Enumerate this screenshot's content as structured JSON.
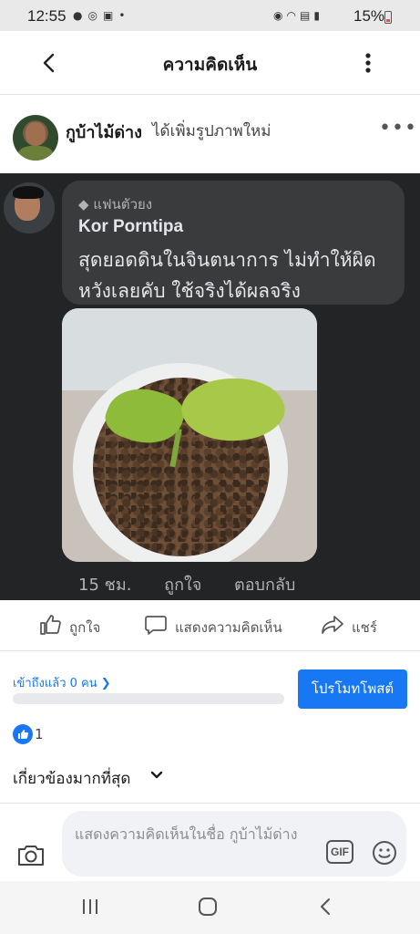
{
  "status_bar": {
    "time": "12:55",
    "battery_percent": "15%",
    "left_icons": [
      "messenger-icon",
      "sync-icon",
      "image-icon",
      "dot-icon"
    ],
    "right_icons": [
      "hotspot-icon",
      "wifi-icon",
      "volte-lte-icon",
      "signal-icon",
      "battery-icon"
    ]
  },
  "app_bar": {
    "title": "ความคิดเห็น"
  },
  "post": {
    "author": "กูบ้าไม้ด่าง",
    "action": "ได้เพิ่มรูปภาพใหม่"
  },
  "comment": {
    "badge": "แฟนตัวยง",
    "author": "Kor Porntipa",
    "text": "สุดยอดดินในจินตนาการ ไม่ทำให้ผิดหวังเลยคับ ใช้จริงได้ผลจริง",
    "time": "15 ชม.",
    "like_label": "ถูกใจ",
    "reply_label": "ตอบกลับ"
  },
  "actions": {
    "like": "ถูกใจ",
    "comment": "แสดงความคิดเห็น",
    "share": "แชร์"
  },
  "insight": {
    "reach": "เข้าถึงแล้ว 0 คน",
    "promote_button": "โปรโมทโพสต์",
    "reach_fraction": 0
  },
  "reactions": {
    "like_count": "1"
  },
  "sort": {
    "label": "เกี่ยวข้องมากที่สุด"
  },
  "composer": {
    "placeholder": "แสดงความคิดเห็นในชื่อ กูบ้าไม้ด่าง",
    "gif_label": "GIF"
  },
  "colors": {
    "brand_blue": "#1877f2",
    "dark_bg": "#222426",
    "bubble_bg": "#3a3b3c"
  }
}
